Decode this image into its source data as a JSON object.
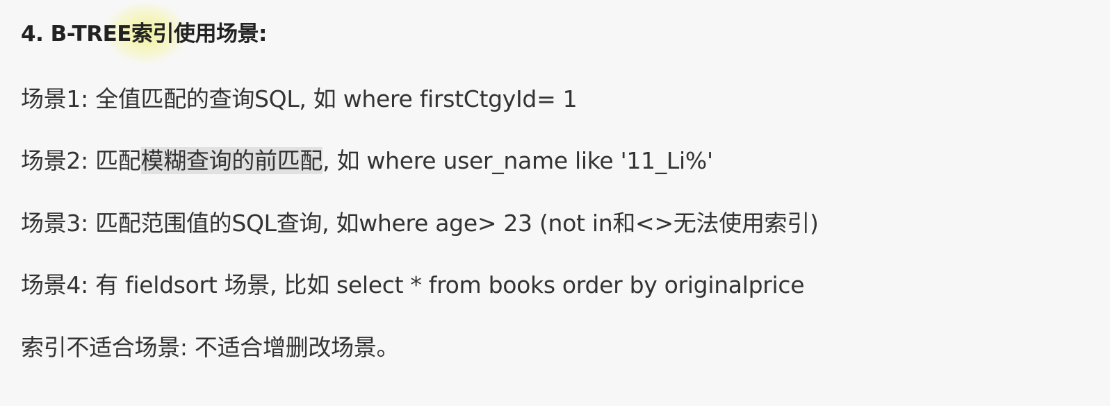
{
  "heading": "4. B-TREE索引使用场景:",
  "scenes": [
    {
      "prefix": "场景1:",
      "text": "全值匹配的查询SQL, 如 where firstCtgyId= 1"
    },
    {
      "prefix": "场景2:",
      "text_before": "匹配",
      "highlight": "模糊查询的前匹配",
      "text_after": ", 如 where user_name like '11_Li%'"
    },
    {
      "prefix": "场景3:",
      "text": "匹配范围值的SQL查询, 如where age> 23 (not in和<>无法使用索引)"
    },
    {
      "prefix": "场景4:",
      "text": "有 fieldsort 场景, 比如 select * from books order by  originalprice"
    }
  ],
  "unsuitable": "索引不适合场景: 不适合增删改场景。"
}
